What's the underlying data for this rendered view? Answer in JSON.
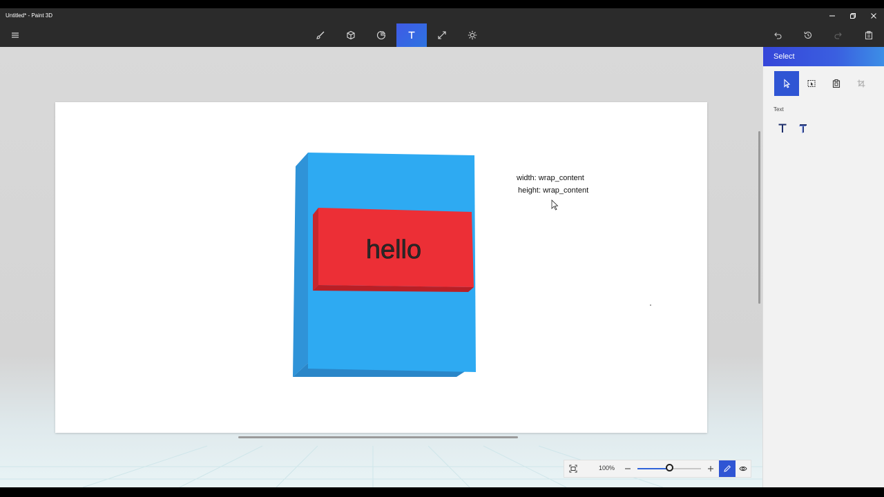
{
  "window": {
    "title": "Untitled* - Paint 3D",
    "controls": [
      "minimize-icon",
      "restore-icon",
      "close-icon"
    ]
  },
  "toolbar": {
    "menu_icon": "menu-icon",
    "tools": [
      {
        "name": "brushes",
        "icon": "brush-icon",
        "active": false
      },
      {
        "name": "3d-shapes",
        "icon": "cube-icon",
        "active": false
      },
      {
        "name": "stickers",
        "icon": "sticker-icon",
        "active": false
      },
      {
        "name": "text",
        "icon": "text-t-icon",
        "active": true
      },
      {
        "name": "effects",
        "icon": "resize-icon",
        "active": false
      },
      {
        "name": "canvas",
        "icon": "sun-icon",
        "active": false
      }
    ],
    "actions": [
      "undo-icon",
      "history-icon",
      "redo-icon",
      "paste-icon"
    ]
  },
  "canvas": {
    "shape_text": "hello",
    "annotations": [
      "width: wrap_content",
      "height: wrap_content"
    ]
  },
  "zoom": {
    "label": "100%",
    "level": 0.5
  },
  "panel": {
    "title": "Select",
    "select_tools": [
      {
        "icon": "cursor-icon",
        "active": true
      },
      {
        "icon": "select-region-icon",
        "active": false
      },
      {
        "icon": "paste-object-icon",
        "active": false
      },
      {
        "icon": "crop-icon",
        "active": false
      }
    ],
    "text_section_label": "Text",
    "text_tools": [
      "text-2d-icon",
      "text-3d-icon"
    ]
  },
  "colors": {
    "accent": "#3a5fe0",
    "toolbar_bg": "#2b2b2b",
    "box_blue": "#2ba8f0",
    "box_red": "#ec2f36"
  }
}
